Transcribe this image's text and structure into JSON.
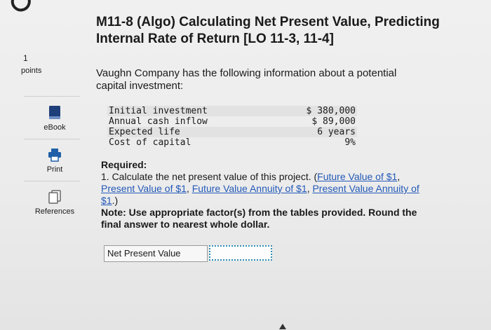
{
  "question": {
    "title_line1": "M11-8 (Algo) Calculating Net Present Value, Predicting",
    "title_line2": "Internal Rate of Return [LO 11-3, 11-4]",
    "points_value": "1",
    "points_label": "points"
  },
  "tools": {
    "ebook": "eBook",
    "print": "Print",
    "references": "References"
  },
  "intro": "Vaughn Company has the following information about a potential capital investment:",
  "investment_table": [
    {
      "label": "Initial investment",
      "value": "$ 380,000"
    },
    {
      "label": "Annual cash inflow",
      "value": "$ 89,000"
    },
    {
      "label": "Expected life",
      "value": "6 years"
    },
    {
      "label": "Cost of capital",
      "value": "9%"
    }
  ],
  "required": {
    "heading": "Required:",
    "prefix": "1. Calculate the net present value of this project. (",
    "link_fv": "Future Value of $1",
    "link_pv": "Present Value of $1",
    "link_fva": "Future Value Annuity of $1",
    "link_pva": "Present Value Annuity of $1",
    "sep": ", ",
    "suffix": ".)",
    "note": "Note: Use appropriate factor(s) from the tables provided. Round the final answer to nearest whole dollar."
  },
  "answer": {
    "label": "Net Present Value",
    "value": "",
    "border_color": "#2a8bb0"
  },
  "colors": {
    "link": "#2359b8",
    "ebook_icon": "#1f3f7a",
    "print_icon": "#1f5fa8"
  },
  "icons": {
    "refresh": "refresh-icon",
    "ebook": "book-icon",
    "print": "printer-icon",
    "references": "documents-icon"
  }
}
